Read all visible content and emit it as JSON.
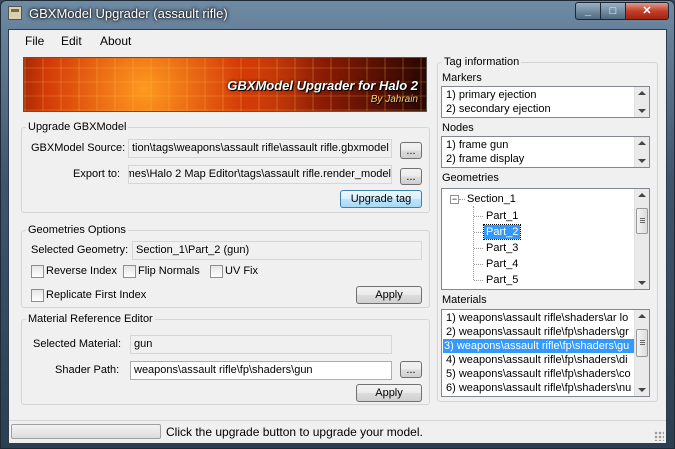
{
  "window": {
    "title": "GBXModel Upgrader (assault rifle)",
    "caption_min": "_",
    "caption_max": "□",
    "caption_close": "✕"
  },
  "menu": {
    "file": "File",
    "edit": "Edit",
    "about": "About"
  },
  "banner": {
    "title": "GBXModel Upgrader for Halo 2",
    "subtitle": "By Jahrain"
  },
  "upgrade": {
    "group_title": "Upgrade GBXModel",
    "source_label": "GBXModel Source:",
    "source_value": "tion\\tags\\weapons\\assault rifle\\assault rifle.gbxmodel",
    "export_label": "Export to:",
    "export_value": "mes\\Halo 2 Map Editor\\tags\\assault rifle.render_model",
    "browse_label": "...",
    "upgrade_button": "Upgrade tag"
  },
  "geometries_options": {
    "group_title": "Geometries Options",
    "selected_label": "Selected Geometry:",
    "selected_value": "Section_1\\Part_2 (gun)",
    "reverse_index": "Reverse Index",
    "flip_normals": "Flip Normals",
    "uv_fix": "UV Fix",
    "replicate_first_index": "Replicate First Index",
    "apply_label": "Apply"
  },
  "material_editor": {
    "group_title": "Material Reference Editor",
    "selected_label": "Selected Material:",
    "selected_value": "gun",
    "shader_label": "Shader Path:",
    "shader_value": "weapons\\assault rifle\\fp\\shaders\\gun",
    "browse_label": "...",
    "apply_label": "Apply"
  },
  "tag_info": {
    "group_title": "Tag information",
    "markers_label": "Markers",
    "markers": [
      "1) primary ejection",
      "2) secondary ejection"
    ],
    "nodes_label": "Nodes",
    "nodes": [
      "1) frame gun",
      "2) frame display"
    ],
    "geometries_label": "Geometries",
    "tree_root": "Section_1",
    "tree_expander": "−",
    "tree_parts": [
      "Part_1",
      "Part_2",
      "Part_3",
      "Part_4",
      "Part_5"
    ],
    "materials_label": "Materials",
    "materials": [
      "1) weapons\\assault rifle\\shaders\\ar lo",
      "2) weapons\\assault rifle\\fp\\shaders\\gr",
      "3) weapons\\assault rifle\\fp\\shaders\\gu",
      "4) weapons\\assault rifle\\fp\\shaders\\di",
      "5) weapons\\assault rifle\\fp\\shaders\\co",
      "6) weapons\\assault rifle\\fp\\shaders\\nu"
    ]
  },
  "status": {
    "message": "Click the upgrade button to upgrade your model."
  },
  "colors": {
    "selection": "#3399ff",
    "window_bg": "#f0f0f0",
    "close_button": "#c2402b"
  }
}
